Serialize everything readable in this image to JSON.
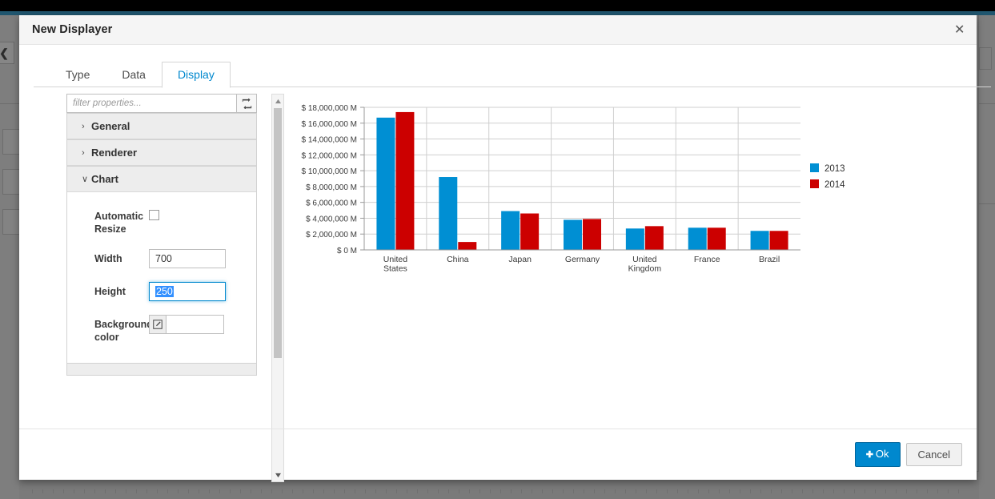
{
  "modal": {
    "title": "New Displayer",
    "close_label": "✕"
  },
  "tabs": [
    {
      "label": "Type",
      "active": false
    },
    {
      "label": "Data",
      "active": false
    },
    {
      "label": "Display",
      "active": true
    }
  ],
  "properties": {
    "filter": {
      "value": "",
      "placeholder": "filter properties...",
      "refresh_icon": "refresh-icon"
    },
    "sections": [
      {
        "label": "General",
        "expanded": false,
        "caret": "›"
      },
      {
        "label": "Renderer",
        "expanded": false,
        "caret": "›"
      },
      {
        "label": "Chart",
        "expanded": true,
        "caret": "∨"
      }
    ],
    "chart_fields": {
      "automatic_resize_label": "Automatic Resize",
      "automatic_resize_checked": false,
      "width_label": "Width",
      "width_value": "700",
      "height_label": "Height",
      "height_value": "250",
      "height_focused": true,
      "background_color_label": "Background color",
      "background_color_value": "",
      "background_color_icon": "pencil-edit-icon"
    }
  },
  "scrollbar": {
    "up_arrow": "▲",
    "down_arrow": "▼"
  },
  "footer": {
    "ok_label": "Ok",
    "ok_icon": "plus-icon",
    "cancel_label": "Cancel"
  },
  "chart_data": {
    "type": "bar",
    "title": "",
    "xlabel": "",
    "ylabel": "",
    "categories": [
      "United States",
      "China",
      "Japan",
      "Germany",
      "United Kingdom",
      "France",
      "Brazil"
    ],
    "series": [
      {
        "name": "2013",
        "color": "#008FD3",
        "values": [
          16700000,
          9200000,
          4900000,
          3800000,
          2700000,
          2800000,
          2400000
        ]
      },
      {
        "name": "2014",
        "color": "#CC0000",
        "values": [
          17400000,
          1000000,
          4600000,
          3900000,
          3000000,
          2800000,
          2400000
        ]
      }
    ],
    "ylim": [
      0,
      18000000
    ],
    "ytick_step": 2000000,
    "ytick_labels": [
      "$ 18,000,000 M",
      "$ 16,000,000 M",
      "$ 14,000,000 M",
      "$ 12,000,000 M",
      "$ 10,000,000 M",
      "$ 8,000,000 M",
      "$ 6,000,000 M",
      "$ 4,000,000 M",
      "$ 2,000,000 M",
      "$ 0 M"
    ],
    "grid": true,
    "legend_position": "right",
    "legend": [
      "2013",
      "2014"
    ]
  },
  "backdrop": {
    "collapse_icon": "chevron-left-icon"
  }
}
